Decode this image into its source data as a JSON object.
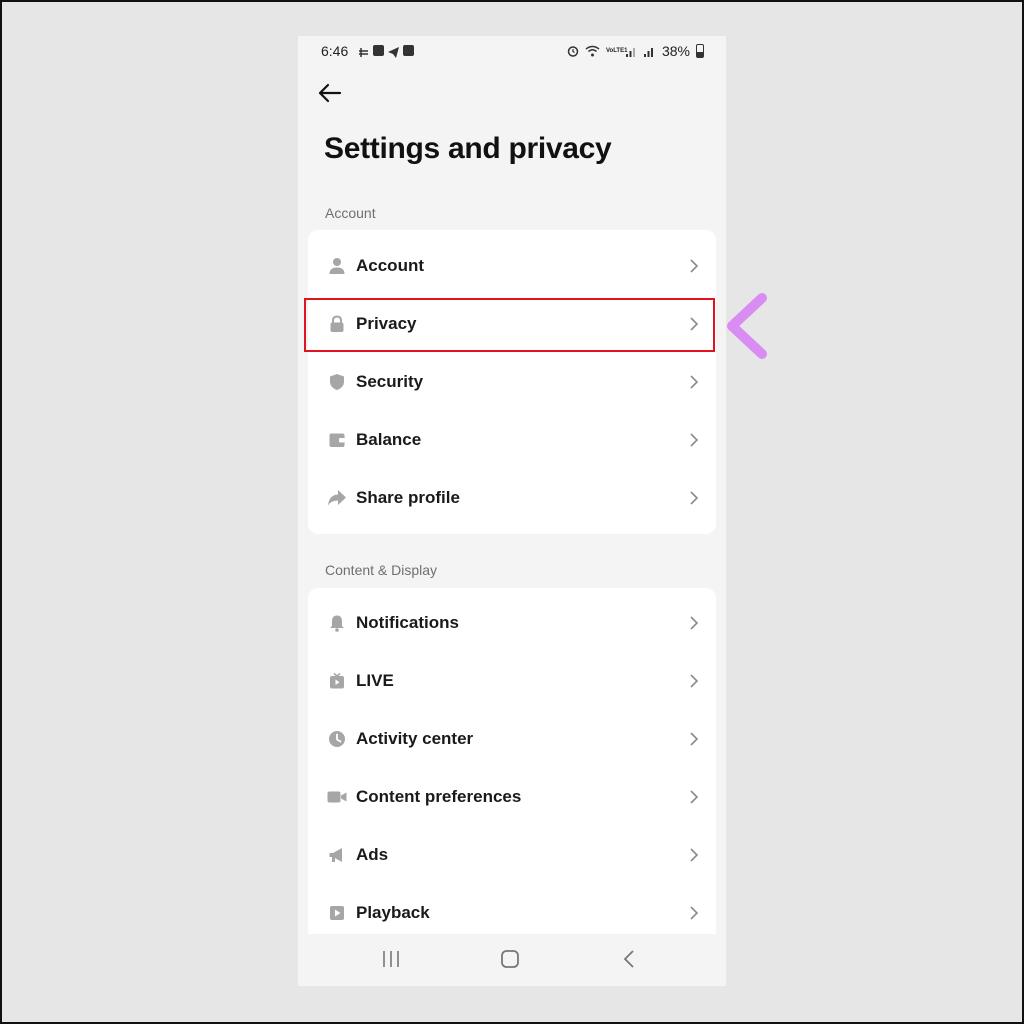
{
  "status_bar": {
    "time": "6:46",
    "battery": "38%",
    "network": "VoLTE1"
  },
  "header": {
    "title": "Settings and privacy"
  },
  "sections": [
    {
      "label": "Account",
      "items": [
        {
          "label": "Account",
          "icon": "person-icon"
        },
        {
          "label": "Privacy",
          "icon": "lock-icon"
        },
        {
          "label": "Security",
          "icon": "shield-icon"
        },
        {
          "label": "Balance",
          "icon": "wallet-icon"
        },
        {
          "label": "Share profile",
          "icon": "share-icon"
        }
      ]
    },
    {
      "label": "Content & Display",
      "items": [
        {
          "label": "Notifications",
          "icon": "bell-icon"
        },
        {
          "label": "LIVE",
          "icon": "live-tv-icon"
        },
        {
          "label": "Activity center",
          "icon": "clock-icon"
        },
        {
          "label": "Content preferences",
          "icon": "video-camera-icon"
        },
        {
          "label": "Ads",
          "icon": "megaphone-icon"
        },
        {
          "label": "Playback",
          "icon": "play-icon"
        }
      ]
    }
  ],
  "colors": {
    "highlight_border": "#e0141f",
    "icon_gray": "#a6a6a6",
    "arrow_gradient_start": "#d98cf2",
    "arrow_gradient_end": "#7fd3f7"
  }
}
